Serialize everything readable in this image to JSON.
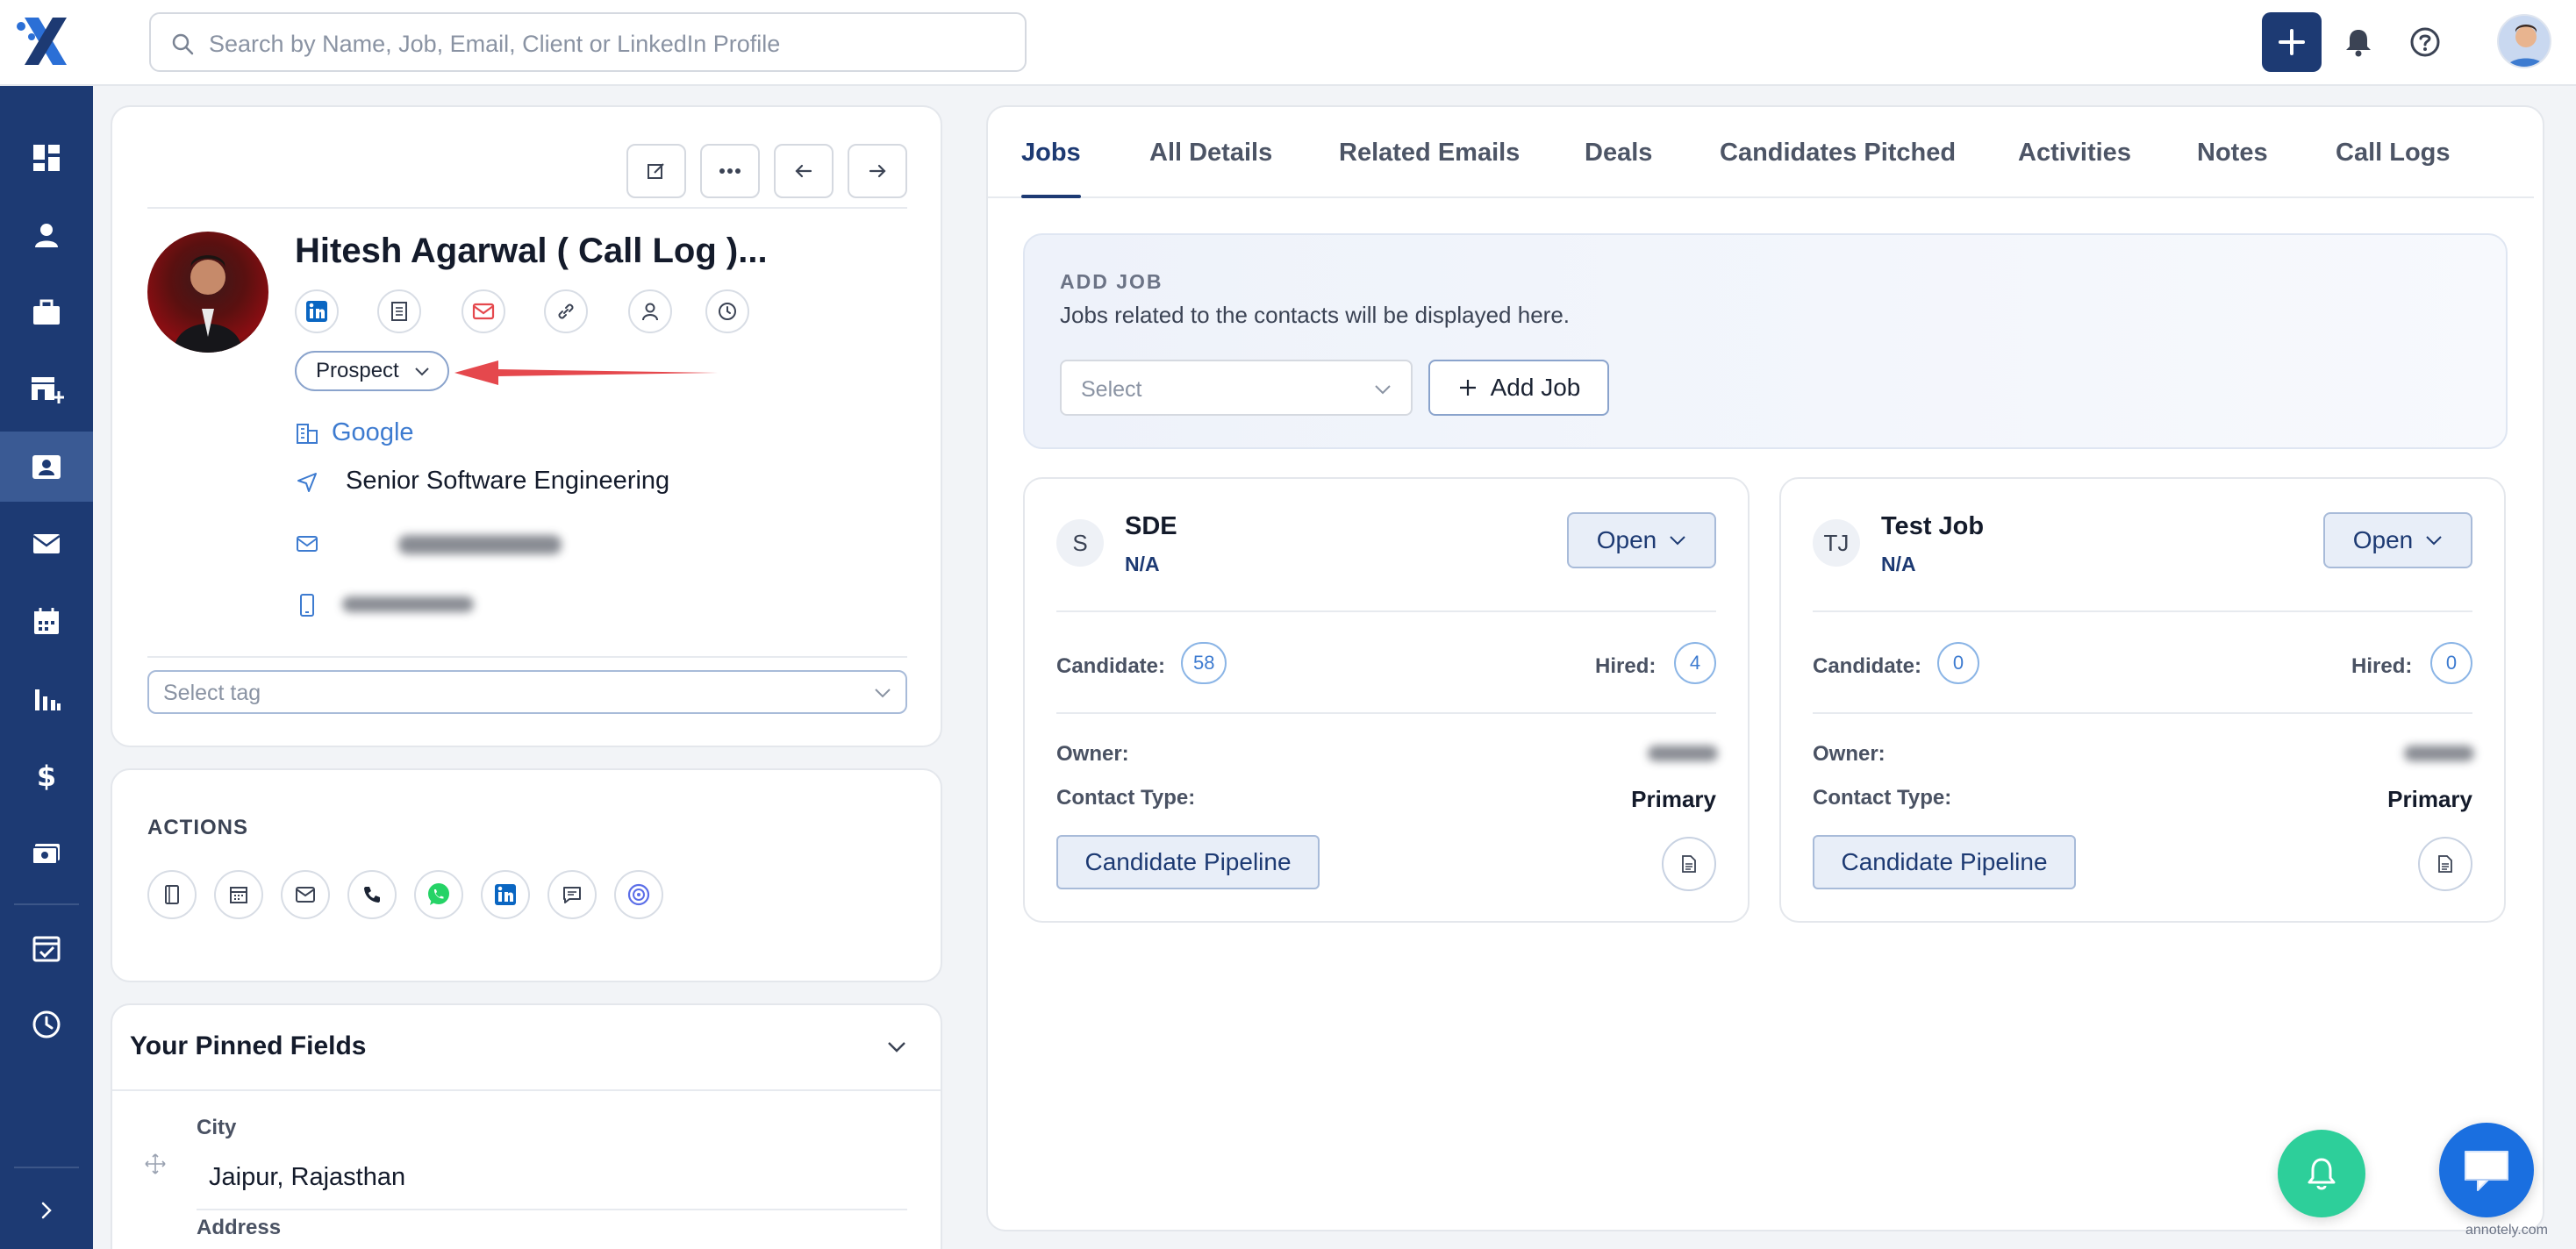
{
  "header": {
    "search_placeholder": "Search by Name, Job, Email, Client or LinkedIn Profile",
    "icons": [
      "logo-icon",
      "search-icon",
      "plus-icon",
      "bell-icon",
      "help-icon",
      "avatar"
    ]
  },
  "sidebar": {
    "items": [
      {
        "icon": "dashboard-icon"
      },
      {
        "icon": "user-icon"
      },
      {
        "icon": "briefcase-icon"
      },
      {
        "icon": "store-add-icon"
      },
      {
        "icon": "contact-card-icon",
        "active": true
      },
      {
        "icon": "mail-icon"
      },
      {
        "icon": "calendar-icon"
      },
      {
        "icon": "reports-icon"
      },
      {
        "icon": "dollar-icon"
      },
      {
        "icon": "money-icon"
      },
      {
        "icon": "task-calendar-icon"
      },
      {
        "icon": "clock-icon"
      },
      {
        "icon": "expand-chevron-icon"
      }
    ]
  },
  "profile": {
    "name": "Hitesh Agarwal ( Call Log )...",
    "status": "Prospect",
    "company": "Google",
    "job_title": "Senior Software Engineering",
    "tag_placeholder": "Select tag"
  },
  "actions": {
    "title": "ACTIONS"
  },
  "pinned": {
    "title": "Your Pinned Fields",
    "fields": [
      {
        "label": "City",
        "value": "Jaipur, Rajasthan"
      },
      {
        "label": "Address",
        "value": ""
      }
    ]
  },
  "tabs": [
    "Jobs",
    "All Details",
    "Related Emails",
    "Deals",
    "Candidates Pitched",
    "Activities",
    "Notes",
    "Call Logs"
  ],
  "add_job": {
    "title": "ADD JOB",
    "description": "Jobs related to the contacts will be displayed here.",
    "select_placeholder": "Select",
    "button_label": "Add Job"
  },
  "jobs": [
    {
      "initials": "S",
      "title": "SDE",
      "subtitle": "N/A",
      "status": "Open",
      "candidate_label": "Candidate:",
      "candidate_count": "58",
      "hired_label": "Hired:",
      "hired_count": "4",
      "owner_label": "Owner:",
      "contact_type_label": "Contact Type:",
      "contact_type": "Primary",
      "pipeline_label": "Candidate Pipeline"
    },
    {
      "initials": "TJ",
      "title": "Test Job",
      "subtitle": "N/A",
      "status": "Open",
      "candidate_label": "Candidate:",
      "candidate_count": "0",
      "hired_label": "Hired:",
      "hired_count": "0",
      "owner_label": "Owner:",
      "contact_type_label": "Contact Type:",
      "contact_type": "Primary",
      "pipeline_label": "Candidate Pipeline"
    }
  ],
  "watermark": "annotely.com",
  "colors": {
    "brand_navy": "#1d3a73",
    "link_blue": "#3d7bd0",
    "bell_green": "#2dcf9a",
    "chat_blue": "#1a6fe0",
    "arrow_red": "#e5484d"
  }
}
